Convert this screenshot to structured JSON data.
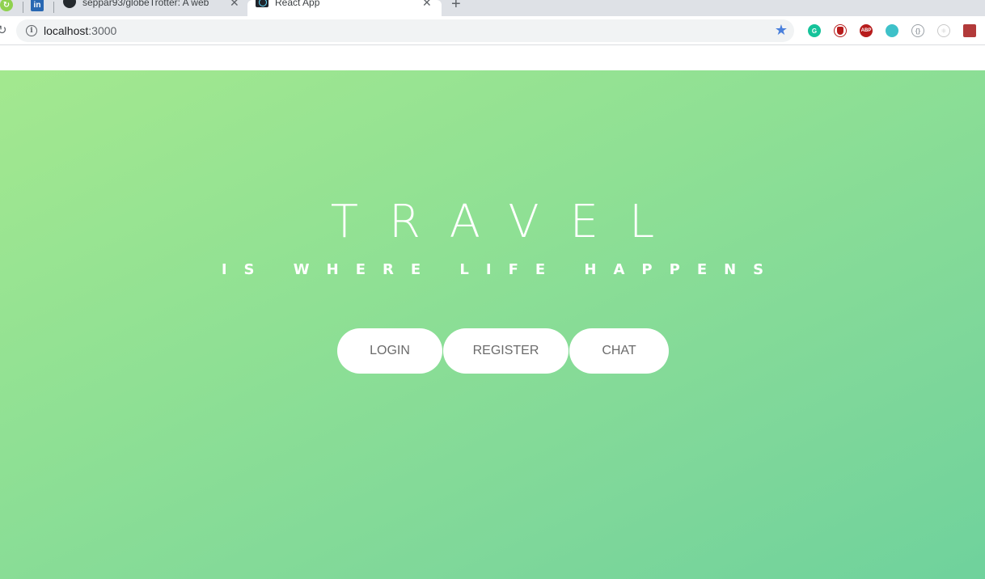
{
  "browser": {
    "tabs": [
      {
        "title": "seppar93/globeTrotter: A web",
        "active": false
      },
      {
        "title": "React App",
        "active": true
      }
    ],
    "url_host": "localhost",
    "url_port": ":3000",
    "extensions": [
      "grammarly-icon",
      "ublock-icon",
      "adblock-plus-icon",
      "teal-extension-icon",
      "code-extension-icon",
      "react-devtools-icon",
      "red-extension-icon"
    ]
  },
  "hero": {
    "title": "TRAVEL",
    "subtitle": "IS WHERE LIFE HAPPENS"
  },
  "buttons": {
    "login": "LOGIN",
    "register": "REGISTER",
    "chat": "CHAT"
  },
  "colors": {
    "gradient_start": "#a3e88f",
    "gradient_end": "#6fd29c",
    "button_text": "#6b6b6b"
  }
}
